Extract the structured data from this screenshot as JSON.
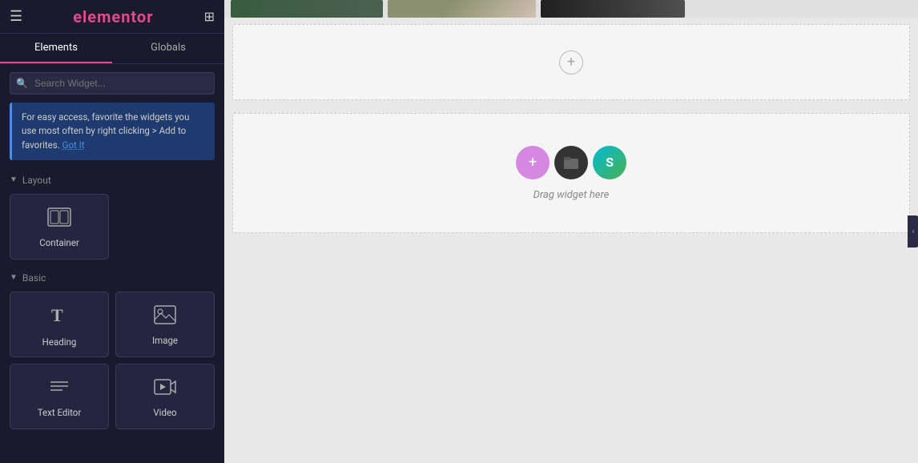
{
  "header": {
    "hamburger_icon": "☰",
    "logo": "elementor",
    "grid_icon": "⊞"
  },
  "tabs": {
    "elements_label": "Elements",
    "globals_label": "Globals",
    "active": "elements"
  },
  "search": {
    "placeholder": "Search Widget..."
  },
  "tip": {
    "text": "For easy access, favorite the widgets you use most often by right clicking > Add to favorites.",
    "got_it": "Got It"
  },
  "layout_section": {
    "label": "Layout",
    "widgets": [
      {
        "name": "container",
        "label": "Container",
        "icon": "container"
      }
    ]
  },
  "basic_section": {
    "label": "Basic",
    "widgets": [
      {
        "name": "heading",
        "label": "Heading",
        "icon": "heading"
      },
      {
        "name": "image",
        "label": "Image",
        "icon": "image"
      },
      {
        "name": "text-editor",
        "label": "Text Editor",
        "icon": "text"
      },
      {
        "name": "video",
        "label": "Video",
        "icon": "video"
      }
    ]
  },
  "canvas": {
    "plus_icon": "+",
    "drag_text": "Drag widget here",
    "drag_icons": [
      {
        "name": "add-circle",
        "symbol": "+",
        "color": "pink"
      },
      {
        "name": "folder-circle",
        "symbol": "📁",
        "color": "dark"
      },
      {
        "name": "star-circle",
        "symbol": "S",
        "color": "gradient"
      }
    ]
  },
  "collapse": {
    "icon": "‹"
  }
}
